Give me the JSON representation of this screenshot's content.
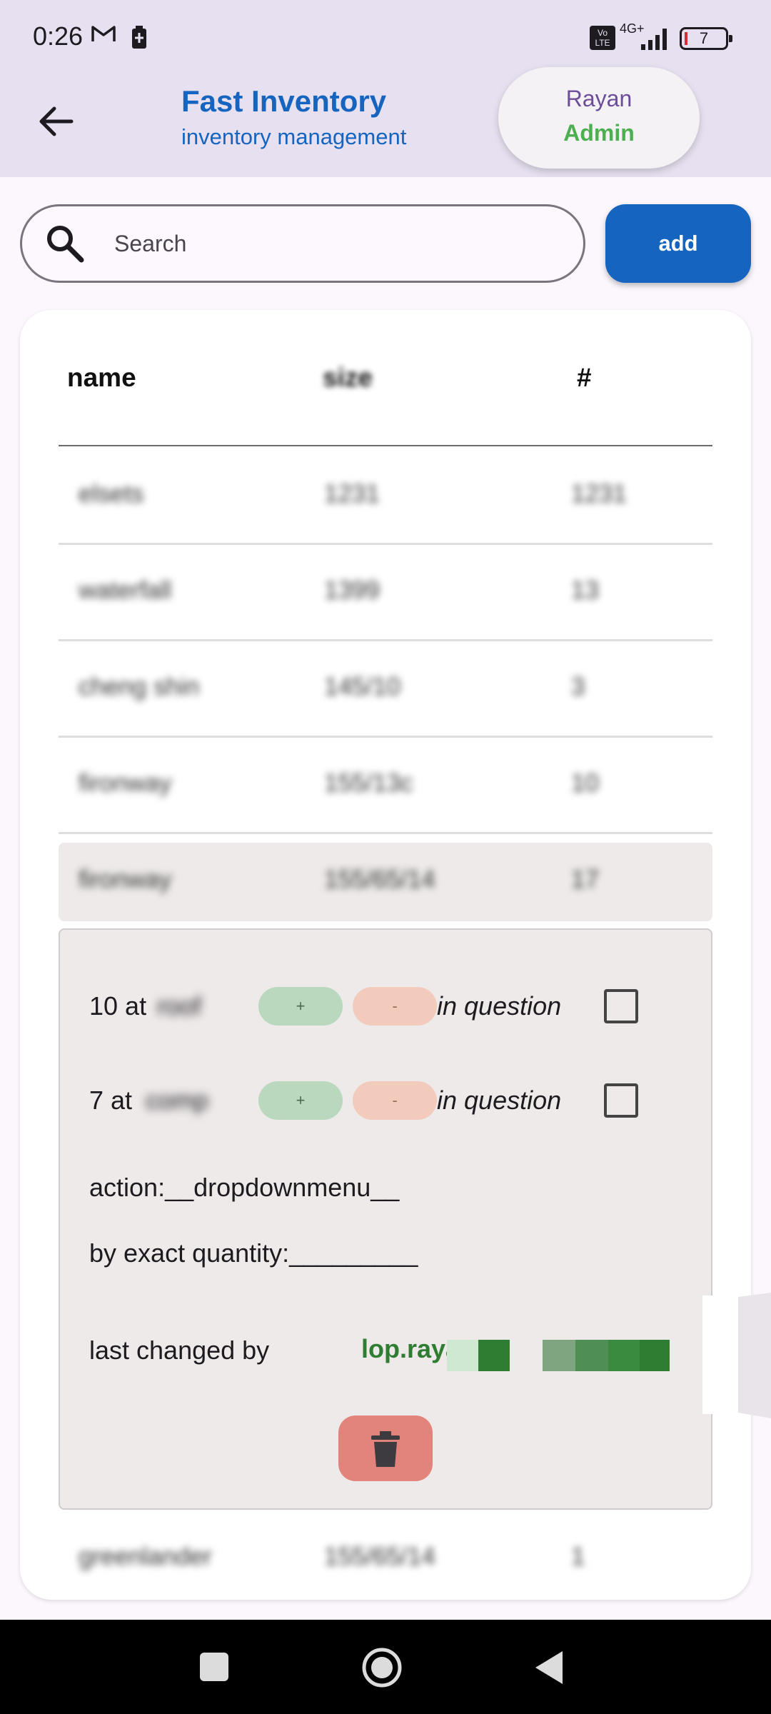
{
  "status_bar": {
    "time": "0:26",
    "volte": "Vo LTE",
    "network": "4G+",
    "battery": "7",
    "icons": [
      "gmail-icon",
      "battery-saver-icon",
      "signal-icon",
      "battery-icon"
    ]
  },
  "app_bar": {
    "title": "Fast Inventory",
    "subtitle": "inventory management",
    "user_name": "Rayan",
    "user_role": "Admin"
  },
  "search": {
    "placeholder": "Search",
    "value": ""
  },
  "add_button": "add",
  "table": {
    "headers": {
      "name": "name",
      "size": "size",
      "count": "#"
    },
    "rows": [
      {
        "name": "elsets",
        "size": "1231",
        "count": "1231"
      },
      {
        "name": "waterfall",
        "size": "1399",
        "count": "13"
      },
      {
        "name": "cheng shin",
        "size": "145/10",
        "count": "3"
      },
      {
        "name": "fironway",
        "size": "155/13c",
        "count": "10"
      },
      {
        "name": "fironway",
        "size": "155/65/14",
        "count": "17"
      },
      {
        "name": "greenlander",
        "size": "155/65/14",
        "count": "1"
      }
    ]
  },
  "details": {
    "locations": [
      {
        "prefix": "10 at",
        "place": "roof",
        "plus": "+",
        "minus": "-",
        "status": "in question",
        "checked": false
      },
      {
        "prefix": "7 at",
        "place": "comp",
        "plus": "+",
        "minus": "-",
        "status": "in question",
        "checked": false
      }
    ],
    "action_label": "action:__dropdownmenu__",
    "quantity_label": "by exact quantity:_________",
    "last_changed_label": "last changed by",
    "last_changed_user": "lop.rayan.",
    "delete_icon": "trash-icon"
  },
  "colors": {
    "primary": "#1565c0",
    "admin_green": "#4caf50",
    "plus_pill": "#b9d8bd",
    "minus_pill": "#f3cbbc",
    "delete": "#e3847c",
    "app_bar": "#e6e0f0"
  }
}
